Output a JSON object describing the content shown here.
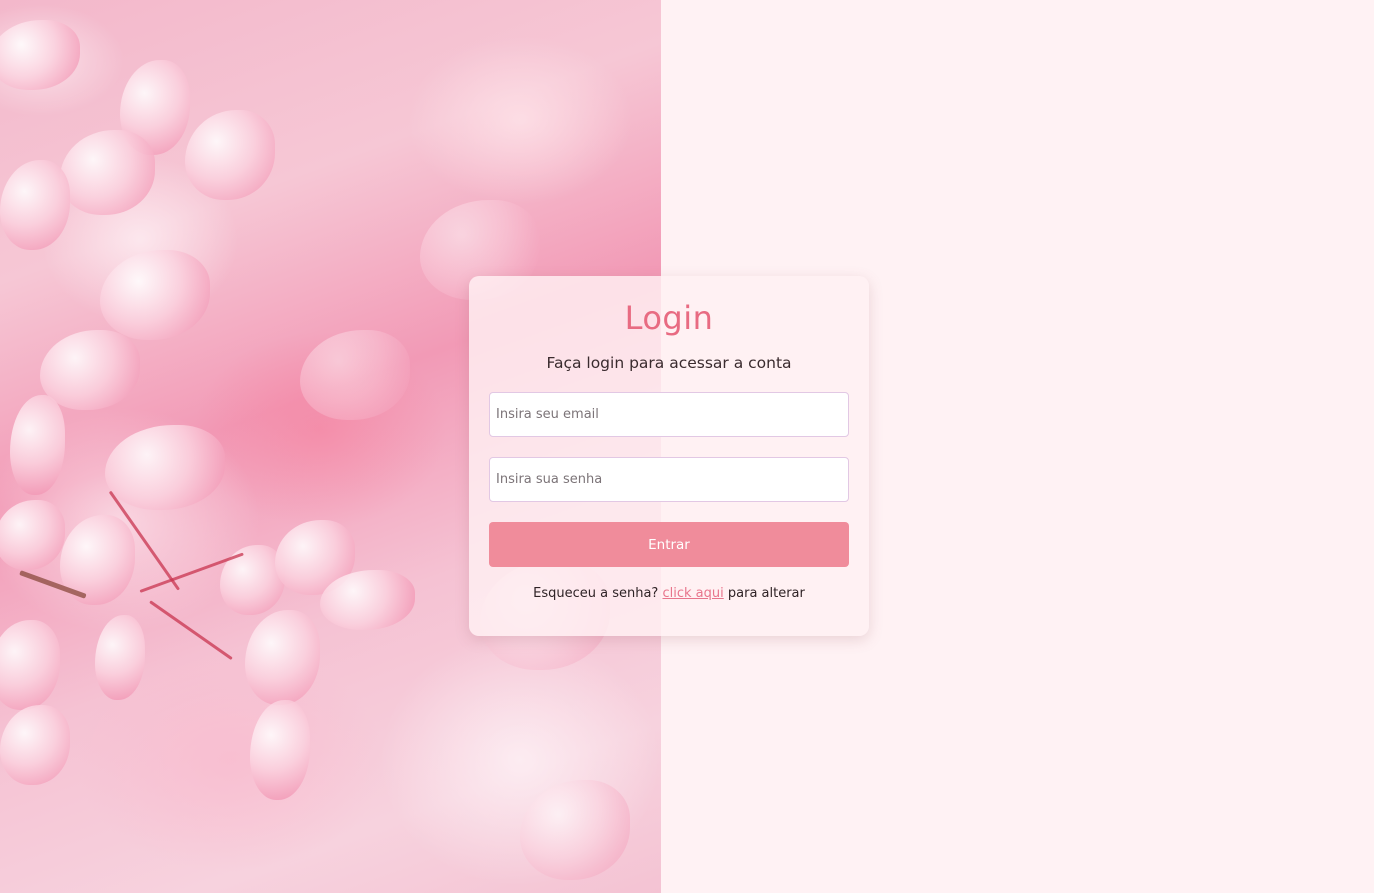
{
  "login": {
    "title": "Login",
    "subtitle": "Faça login para acessar a conta",
    "email_placeholder": "Insira seu email",
    "password_placeholder": "Insira sua senha",
    "submit_label": "Entrar",
    "forgot_prefix": "Esqueceu a senha?",
    "forgot_link": "click aqui",
    "forgot_suffix": "para alterar"
  },
  "colors": {
    "background": "#fff2f4",
    "title": "#e86b82",
    "button": "#f08c9b",
    "link": "#e8758c"
  },
  "images": {
    "side_photo": "pink-cherry-blossom-photo"
  }
}
